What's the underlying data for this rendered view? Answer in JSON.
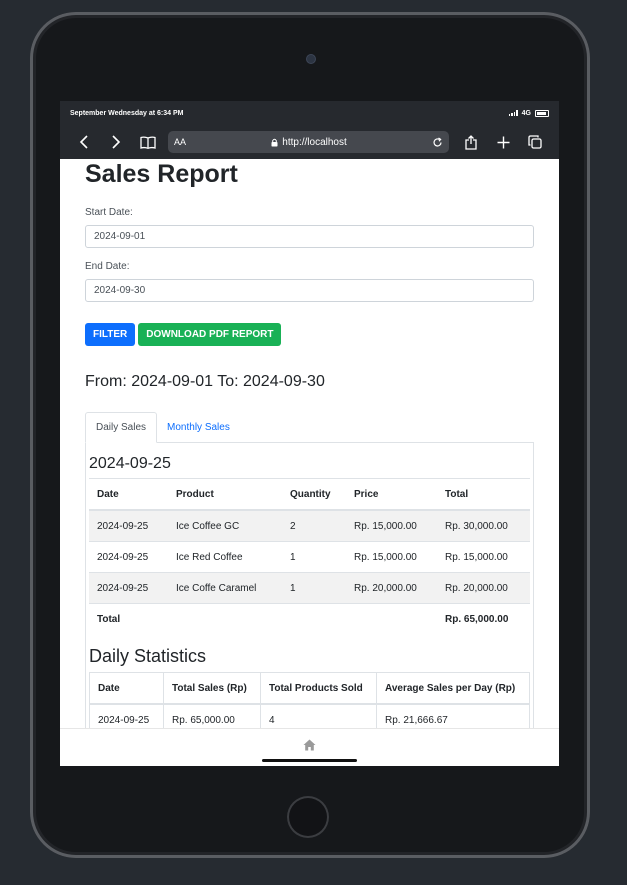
{
  "statusbar": {
    "time_text": "September Wednesday at 6:34 PM",
    "network": "4G"
  },
  "browser": {
    "text_size_label": "AA",
    "url": "http://localhost"
  },
  "page": {
    "title": "Sales Report",
    "start_date_label": "Start Date:",
    "start_date_value": "2024-09-01",
    "end_date_label": "End Date:",
    "end_date_value": "2024-09-30",
    "filter_label": "Filter",
    "download_label": "Download PDF Report",
    "range_text": "From: 2024-09-01 To: 2024-09-30"
  },
  "tabs": [
    {
      "label": "Daily Sales"
    },
    {
      "label": "Monthly Sales"
    }
  ],
  "daily": {
    "date_heading": "2024-09-25",
    "headers": [
      "Date",
      "Product",
      "Quantity",
      "Price",
      "Total"
    ],
    "rows": [
      [
        "2024-09-25",
        "Ice Coffee GC",
        "2",
        "Rp. 15,000.00",
        "Rp. 30,000.00"
      ],
      [
        "2024-09-25",
        "Ice Red Coffee",
        "1",
        "Rp. 15,000.00",
        "Rp. 15,000.00"
      ],
      [
        "2024-09-25",
        "Ice Coffe Caramel",
        "1",
        "Rp. 20,000.00",
        "Rp. 20,000.00"
      ]
    ],
    "total_label": "Total",
    "total_value": "Rp. 65,000.00"
  },
  "statistics": {
    "heading": "Daily Statistics",
    "headers": [
      "Date",
      "Total Sales (Rp)",
      "Total Products Sold",
      "Average Sales per Day (Rp)"
    ],
    "rows": [
      [
        "2024-09-25",
        "Rp. 65,000.00",
        "4",
        "Rp. 21,666.67"
      ]
    ]
  },
  "icons": {
    "back": "chevron-left-icon",
    "forward": "chevron-right-icon",
    "bookmarks": "book-icon",
    "lock": "lock-icon",
    "reload": "reload-icon",
    "share": "share-icon",
    "new_tab": "plus-icon",
    "tabs": "tabs-icon",
    "home": "home-icon"
  }
}
